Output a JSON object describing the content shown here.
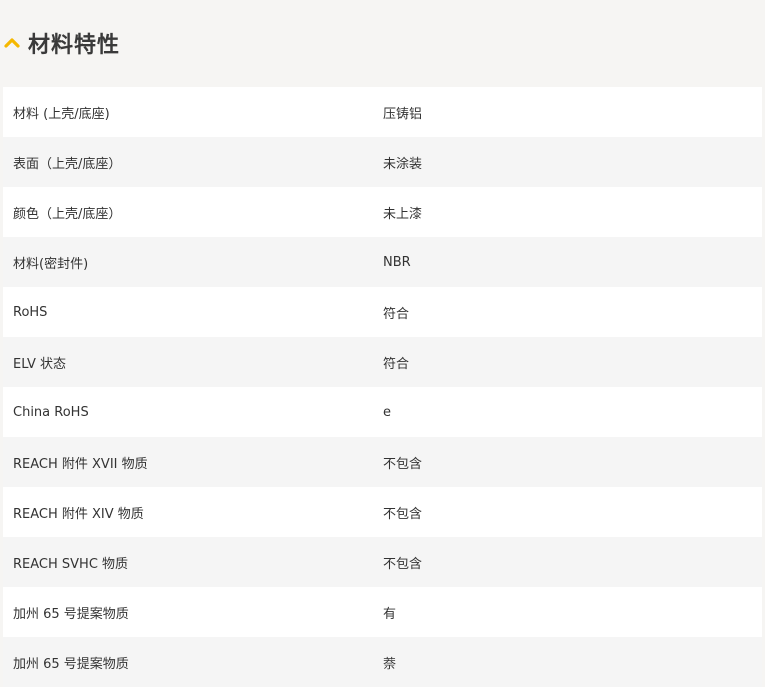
{
  "header": {
    "title": "材料特性",
    "chevron_icon": "chevron-up-icon",
    "accent_color": "#f5b800"
  },
  "rows": [
    {
      "label": "材料 (上壳/底座)",
      "value": "压铸铝"
    },
    {
      "label": "表面（上壳/底座）",
      "value": "未涂装"
    },
    {
      "label": "颜色（上壳/底座）",
      "value": "未上漆"
    },
    {
      "label": "材料(密封件)",
      "value": "NBR"
    },
    {
      "label": "RoHS",
      "value": "符合"
    },
    {
      "label": "ELV 状态",
      "value": "符合"
    },
    {
      "label": "China RoHS",
      "value": "e"
    },
    {
      "label": "REACH 附件 XVII 物质",
      "value": "不包含"
    },
    {
      "label": "REACH 附件 XIV 物质",
      "value": "不包含"
    },
    {
      "label": "REACH SVHC 物质",
      "value": "不包含"
    },
    {
      "label": "加州 65 号提案物质",
      "value": "有"
    },
    {
      "label": "加州 65 号提案物质",
      "value": "萘"
    }
  ]
}
